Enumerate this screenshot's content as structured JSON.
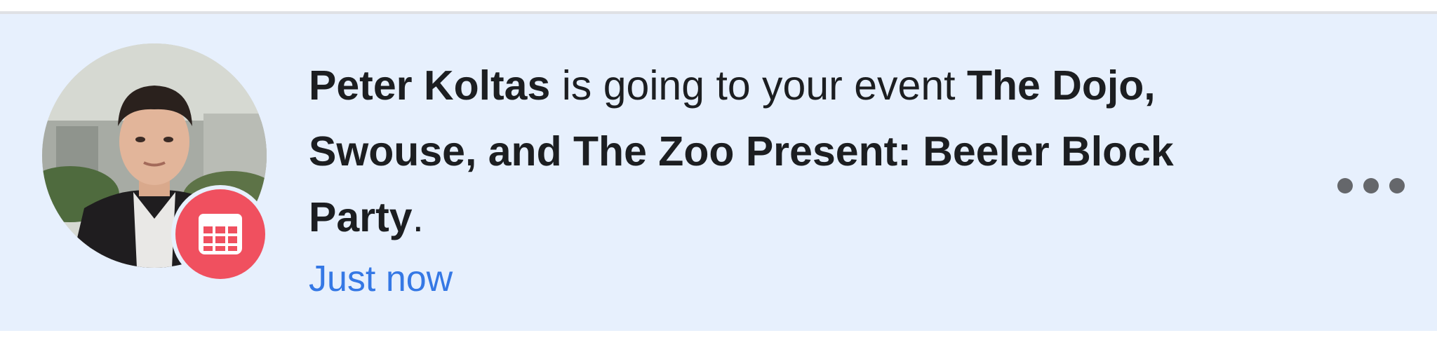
{
  "notification": {
    "actor_name": "Peter Koltas",
    "action_text": " is going to your event ",
    "event_name": "The Dojo, Swouse, and The Zoo Present: Beeler Block Party",
    "end_punctuation": ".",
    "timestamp": "Just now",
    "is_unread": true,
    "badge_icon": "calendar-icon",
    "more_icon": "more-horizontal-icon"
  },
  "colors": {
    "unread_background": "#e7f0fd",
    "timestamp_link": "#3578e5",
    "badge": "#f0505f",
    "text": "#1c1e21",
    "more_dots": "#65676b"
  }
}
